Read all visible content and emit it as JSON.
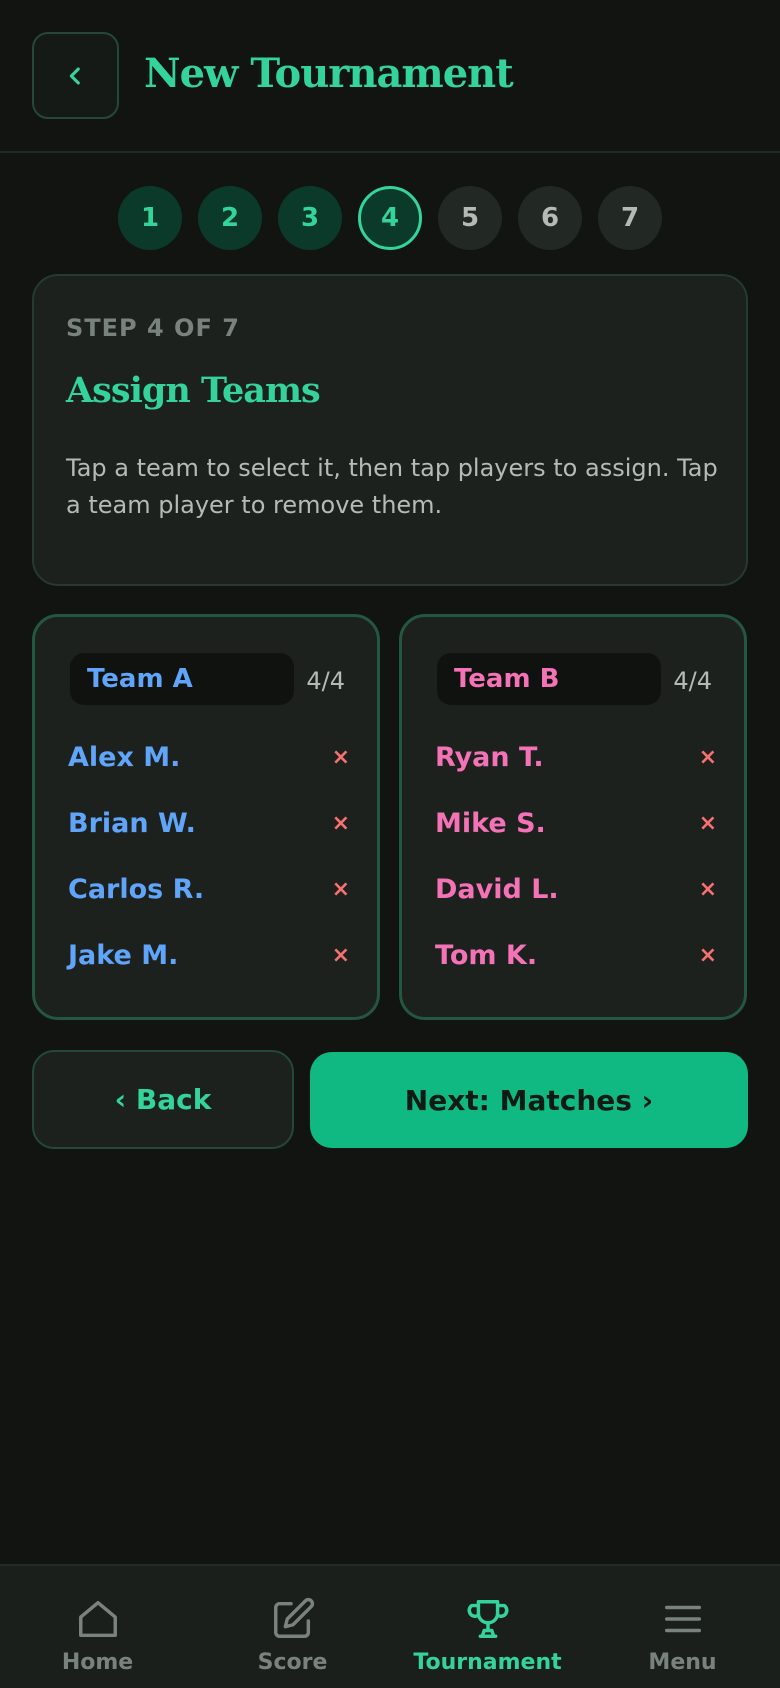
{
  "header": {
    "title": "New Tournament",
    "back_icon": "chevron-left-icon"
  },
  "stepper": {
    "current": 4,
    "steps": [
      "1",
      "2",
      "3",
      "4",
      "5",
      "6",
      "7"
    ]
  },
  "info": {
    "step_label": "STEP 4 OF 7",
    "title": "Assign Teams",
    "description": "Tap a team to select it, then tap players to assign. Tap a team player to remove them."
  },
  "teams": [
    {
      "name": "Team A",
      "count": "4/4",
      "color": "#60a5fa",
      "players": [
        "Alex M.",
        "Brian W.",
        "Carlos R.",
        "Jake M."
      ]
    },
    {
      "name": "Team B",
      "count": "4/4",
      "color": "#f472b6",
      "players": [
        "Ryan T.",
        "Mike S.",
        "David L.",
        "Tom K."
      ]
    }
  ],
  "remove_symbol": "×",
  "actions": {
    "back_label": "‹ Back",
    "next_label": "Next: Matches ›"
  },
  "nav": {
    "active": "Tournament",
    "items": [
      {
        "label": "Home",
        "icon": "home-icon"
      },
      {
        "label": "Score",
        "icon": "edit-icon"
      },
      {
        "label": "Tournament",
        "icon": "trophy-icon"
      },
      {
        "label": "Menu",
        "icon": "menu-icon"
      }
    ]
  },
  "colors": {
    "accent": "#34d399",
    "primary_button": "#10b981",
    "remove": "#f87171"
  }
}
